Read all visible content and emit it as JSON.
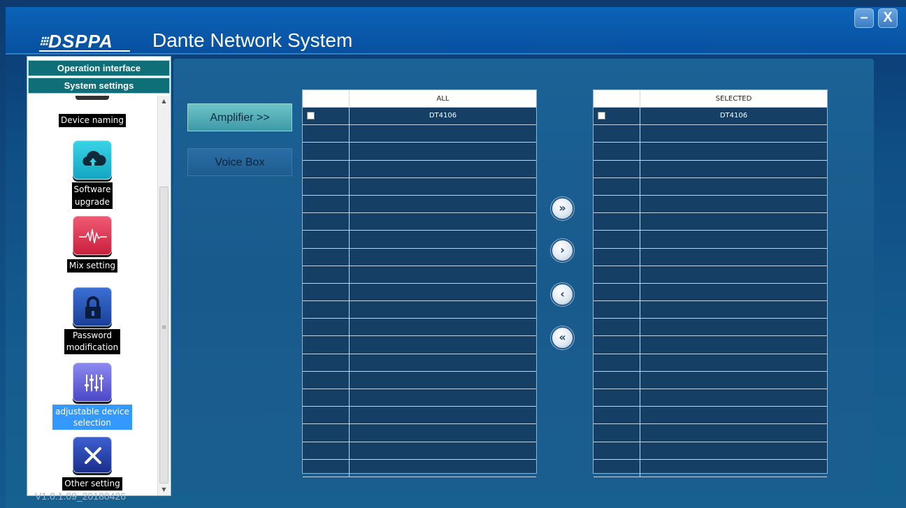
{
  "window": {
    "brand": "DSPPA",
    "title": "Dante Network System",
    "minimize_label": "–",
    "close_label": "X",
    "version": "V1.0.1.09_20180426"
  },
  "sidebar": {
    "tabs": [
      {
        "label": "Operation interface"
      },
      {
        "label": "System settings"
      }
    ],
    "items": [
      {
        "label": "Device naming",
        "icon": "device-naming-icon"
      },
      {
        "label_line1": "Software",
        "label_line2": "upgrade",
        "icon": "cloud-upload-icon",
        "color": "#1fb7cf"
      },
      {
        "label": "Mix setting",
        "icon": "audio-wave-icon",
        "color": "#e03a54"
      },
      {
        "label_line1": "Password",
        "label_line2": "modification",
        "icon": "lock-icon",
        "color": "#1f4ea8"
      },
      {
        "label_line1": "adjustable device",
        "label_line2": "selection",
        "icon": "equalizer-icon",
        "color": "#5b56d4",
        "selected": true
      },
      {
        "label": "Other setting",
        "icon": "tools-icon",
        "color": "#1f3fa8"
      }
    ]
  },
  "categories": {
    "amplifier": "Amplifier >>",
    "voice_box": "Voice Box"
  },
  "tables": {
    "all": {
      "header": "ALL",
      "rows": [
        "DT4106"
      ]
    },
    "selected": {
      "header": "SELECTED",
      "rows": [
        "DT4106"
      ]
    }
  },
  "move_buttons": {
    "all_right": "»",
    "right": "›",
    "left": "‹",
    "all_left": "«"
  }
}
